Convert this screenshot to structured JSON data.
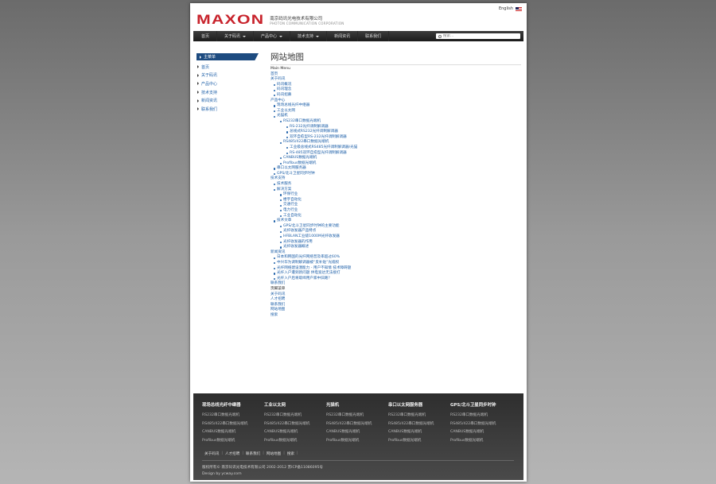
{
  "header": {
    "language": "English",
    "logo_mark": "MAXON",
    "company_cn": "南京码讯光电技术有限公司",
    "company_en": "PHOTON COMMUNICATION CORPORATION"
  },
  "nav": {
    "items": [
      {
        "label": "首页",
        "dropdown": false
      },
      {
        "label": "关于码讯",
        "dropdown": true
      },
      {
        "label": "产品中心",
        "dropdown": true
      },
      {
        "label": "技术支持",
        "dropdown": true
      },
      {
        "label": "新闻资讯",
        "dropdown": false
      },
      {
        "label": "联系我们",
        "dropdown": false
      }
    ],
    "search_placeholder": "搜索..."
  },
  "sidebar": {
    "header": "主菜单",
    "items": [
      "首页",
      "关于码讯",
      "产品中心",
      "技术支持",
      "新闻资讯",
      "联系我们"
    ]
  },
  "content": {
    "title": "网站地图",
    "main_menu_label": "Main Menu",
    "lines": [
      {
        "t": "首页",
        "l": 0
      },
      {
        "t": "关于码讯",
        "l": 0
      },
      {
        "t": "码讯概况",
        "l": 1
      },
      {
        "t": "码讯理念",
        "l": 1
      },
      {
        "t": "码讯招募",
        "l": 1
      },
      {
        "t": "产品中心",
        "l": 0
      },
      {
        "t": "现场总线光纤中继器",
        "l": 1
      },
      {
        "t": "工业以太网",
        "l": 1
      },
      {
        "t": "光猫机",
        "l": 1
      },
      {
        "t": "RS232串口数据光端机",
        "l": 2
      },
      {
        "t": "RS-232光纤调制解调器",
        "l": 3
      },
      {
        "t": "总线式RS232光纤调制解调器",
        "l": 3
      },
      {
        "t": "双环自愈型RS-232光纤调制解调器",
        "l": 3
      },
      {
        "t": "RS485/422串口数据光端机",
        "l": 2
      },
      {
        "t": "工业级总线式RS485光纤调制解调器/光猫",
        "l": 3
      },
      {
        "t": "RS-485双环自愈型光纤调制解调器",
        "l": 3
      },
      {
        "t": "CANBUS数据光端机",
        "l": 2
      },
      {
        "t": "Profibus数据光端机",
        "l": 2
      },
      {
        "t": "串口以太网服务器",
        "l": 1
      },
      {
        "t": "GPS/北斗卫星同步时钟",
        "l": 1
      },
      {
        "t": "技术支持",
        "l": 0
      },
      {
        "t": "技术服务",
        "l": 1
      },
      {
        "t": "解决方案",
        "l": 1
      },
      {
        "t": "环保行业",
        "l": 2
      },
      {
        "t": "楼宇自动化",
        "l": 2
      },
      {
        "t": "交通行业",
        "l": 2
      },
      {
        "t": "电力行业",
        "l": 2
      },
      {
        "t": "工业自动化",
        "l": 2
      },
      {
        "t": "技术文章",
        "l": 1
      },
      {
        "t": "GPS/北斗卫星同步时钟的主要功能",
        "l": 2
      },
      {
        "t": "光纤收发器产品特点",
        "l": 2
      },
      {
        "t": "HFBLAN工业级1000M光纤收发器",
        "l": 2
      },
      {
        "t": "光纤收发器的作用",
        "l": 2
      },
      {
        "t": "光纤收发器概述",
        "l": 2
      },
      {
        "t": "新闻资讯",
        "l": 0
      },
      {
        "t": "日本和韩国的光纤网络普及率超过60%",
        "l": 1
      },
      {
        "t": "中兴华为调制解调器被“反补贴”光缆权",
        "l": 1
      },
      {
        "t": "光纤网络建设潜能力 - 用户不知情 技术障碍题",
        "l": 1
      },
      {
        "t": "光纤入户遭到新问题 供电宽达无法接打",
        "l": 1
      },
      {
        "t": "光纤入户后将取缔用户家中旧路？",
        "l": 1
      },
      {
        "t": "联系我们",
        "l": 0
      },
      {
        "t": "页脚菜单",
        "l": -1
      },
      {
        "t": "关于码讯",
        "l": 0
      },
      {
        "t": "人才招聘",
        "l": 0
      },
      {
        "t": "联系我们",
        "l": 0
      },
      {
        "t": "网站地图",
        "l": 0
      },
      {
        "t": "搜索",
        "l": 0
      }
    ]
  },
  "footer": {
    "columns": [
      {
        "title": "现场总线光纤中继器",
        "items": [
          "RS232串口数据光端机",
          "RS485/422串口数据光端机",
          "CANBUS数据光端机",
          "Profibus数据光端机"
        ]
      },
      {
        "title": "工业以太网",
        "items": [
          "RS232串口数据光端机",
          "RS485/422串口数据光端机",
          "CANBUS数据光端机",
          "Profibus数据光端机"
        ]
      },
      {
        "title": "光猫机",
        "items": [
          "RS232串口数据光端机",
          "RS485/422串口数据光端机",
          "CANBUS数据光端机",
          "Profibus数据光端机"
        ]
      },
      {
        "title": "串口以太网服务器",
        "items": [
          "RS232串口数据光端机",
          "RS485/422串口数据光端机",
          "CANBUS数据光端机",
          "Profibus数据光端机"
        ]
      },
      {
        "title": "GPS/北斗卫星同步时钟",
        "items": [
          "RS232串口数据光端机",
          "RS485/422串口数据光端机",
          "CANBUS数据光端机",
          "Profibus数据光端机"
        ]
      }
    ],
    "links": [
      "关于码讯",
      "人才招聘",
      "联系我们",
      "网站地图",
      "搜索"
    ],
    "copyright": "版权所有© 南京码讯光电技术有限公司  2002-2012    苏ICP备11086095号",
    "design": "Design by ycway.com"
  }
}
